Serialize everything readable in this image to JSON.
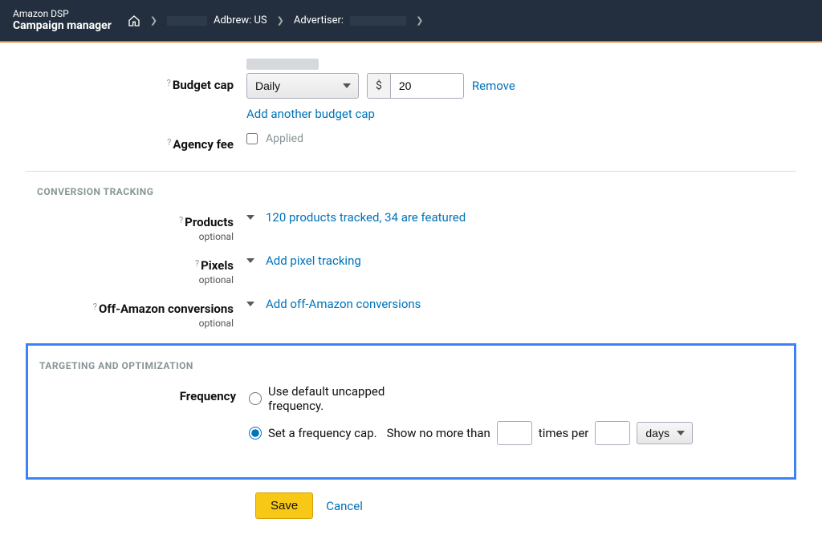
{
  "header": {
    "brand_top": "Amazon DSP",
    "brand_bottom": "Campaign manager",
    "breadcrumb": {
      "item1": "Adbrew: US",
      "item2": "Advertiser:"
    }
  },
  "budget": {
    "label": "Budget cap",
    "period_options": [
      "Daily"
    ],
    "period_selected": "Daily",
    "currency": "$",
    "amount": "20",
    "remove": "Remove",
    "add_link": "Add another budget cap"
  },
  "agency": {
    "label": "Agency fee",
    "applied": "Applied"
  },
  "conversion": {
    "header": "CONVERSION TRACKING",
    "products": {
      "label": "Products",
      "optional": "optional",
      "summary": "120 products tracked, 34 are featured"
    },
    "pixels": {
      "label": "Pixels",
      "optional": "optional",
      "action": "Add pixel tracking"
    },
    "off_amazon": {
      "label": "Off-Amazon conversions",
      "optional": "optional",
      "action": "Add off-Amazon conversions"
    }
  },
  "targeting": {
    "header": "TARGETING AND OPTIMIZATION",
    "frequency_label": "Frequency",
    "option_default": "Use default uncapped frequency.",
    "option_cap": "Set a frequency cap.",
    "cap_phrase_1": "Show no more than",
    "cap_phrase_2": "times per",
    "unit_options": [
      "days"
    ],
    "unit_selected": "days",
    "show_value": "",
    "per_value": ""
  },
  "actions": {
    "save": "Save",
    "cancel": "Cancel"
  }
}
